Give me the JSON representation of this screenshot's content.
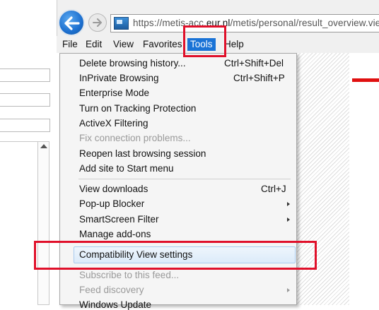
{
  "browser": {
    "url_prefix": "https://metis-acc.",
    "url_host": "eur.nl",
    "url_path": "/metis/personal/result_overview.view"
  },
  "menubar": {
    "items": [
      {
        "label": "File"
      },
      {
        "label": "Edit"
      },
      {
        "label": "View"
      },
      {
        "label": "Favorites"
      },
      {
        "label": "Tools"
      },
      {
        "label": "Help"
      }
    ]
  },
  "tools_menu": {
    "items": [
      {
        "label": "Delete browsing history...",
        "shortcut": "Ctrl+Shift+Del",
        "enabled": true
      },
      {
        "label": "InPrivate Browsing",
        "shortcut": "Ctrl+Shift+P",
        "enabled": true
      },
      {
        "label": "Enterprise Mode",
        "shortcut": "",
        "enabled": true
      },
      {
        "label": "Turn on Tracking Protection",
        "shortcut": "",
        "enabled": true
      },
      {
        "label": "ActiveX Filtering",
        "shortcut": "",
        "enabled": true
      },
      {
        "label": "Fix connection problems...",
        "shortcut": "",
        "enabled": false
      },
      {
        "label": "Reopen last browsing session",
        "shortcut": "",
        "enabled": true
      },
      {
        "label": "Add site to Start menu",
        "shortcut": "",
        "enabled": true
      },
      {
        "label": "View downloads",
        "shortcut": "Ctrl+J",
        "enabled": true
      },
      {
        "label": "Pop-up Blocker",
        "shortcut": "",
        "enabled": true,
        "submenu": true
      },
      {
        "label": "SmartScreen Filter",
        "shortcut": "",
        "enabled": true,
        "submenu": true
      },
      {
        "label": "Manage add-ons",
        "shortcut": "",
        "enabled": true
      },
      {
        "label": "Compatibility View settings",
        "shortcut": "",
        "enabled": true,
        "hovered": true
      },
      {
        "label": "Subscribe to this feed...",
        "shortcut": "",
        "enabled": false
      },
      {
        "label": "Feed discovery",
        "shortcut": "",
        "enabled": false,
        "submenu": true
      },
      {
        "label": "Windows Update",
        "shortcut": "",
        "enabled": true
      }
    ]
  },
  "colors": {
    "highlight_box": "#e0102a",
    "menu_selected": "#1a73d6"
  },
  "icons": [
    "back-arrow-icon",
    "forward-arrow-icon",
    "site-favicon-icon",
    "submenu-arrow-icon",
    "scroll-up-arrow-icon"
  ]
}
